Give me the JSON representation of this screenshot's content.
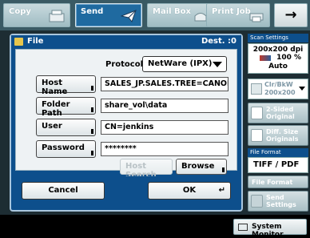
{
  "tabs": [
    {
      "label": "Copy",
      "icon": "copy-icon",
      "active": false
    },
    {
      "label": "Send",
      "icon": "send-icon",
      "active": true
    },
    {
      "label": "Mail Box",
      "icon": "mailbox-icon",
      "active": false
    },
    {
      "label": "Print Job",
      "icon": "print-job-icon",
      "active": false
    }
  ],
  "next_arrow": "→",
  "dialog": {
    "title": "File",
    "dest": "Dest. :0",
    "protocol_label": "Protocol:",
    "protocol_value": "NetWare (IPX)",
    "fields": [
      {
        "button": "Host Name",
        "value": "SALES_JP.SALES.TREE=CANON"
      },
      {
        "button": "Folder Path",
        "value": "share_vol\\data"
      },
      {
        "button": "User",
        "value": "CN=jenkins"
      },
      {
        "button": "Password",
        "value": "********"
      }
    ],
    "host_search": "Host Search",
    "browse": "Browse",
    "cancel": "Cancel",
    "ok": "OK"
  },
  "right_panel": {
    "scan_settings_title": "Scan Settings",
    "resolution": "200x200 dpi",
    "zoom": "100 %",
    "density": "Auto",
    "color_mode": "Clr/BkW",
    "color_res": "200x200",
    "two_sided": "2-Sided Original",
    "diff_size": "Diff. Size Originals",
    "file_format_title": "File Format",
    "file_format_value": "TIFF / PDF",
    "file_format_btn": "File Format",
    "send_settings": "Send Settings"
  },
  "system_monitor": "System Monitor"
}
